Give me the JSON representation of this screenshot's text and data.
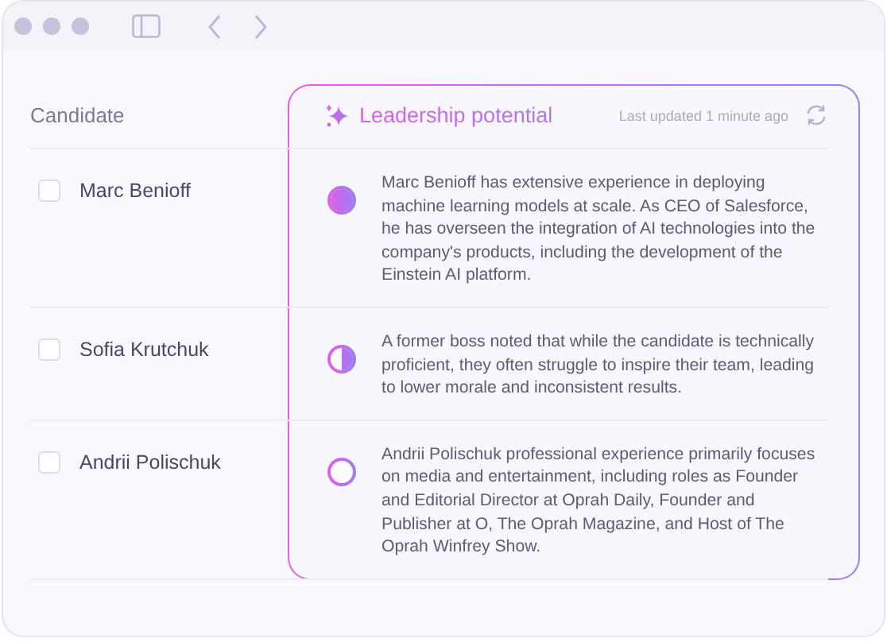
{
  "table": {
    "column_header": "Candidate",
    "panel": {
      "title": "Leadership potential",
      "updated": "Last updated 1 minute ago"
    },
    "rows": [
      {
        "name": "Marc Benioff",
        "checked": false,
        "level": 1,
        "summary": "Marc Benioff has extensive experience in deploying machine learning models at scale. As CEO of Salesforce, he has overseen the integration of AI technologies into the company's products, including the development of the Einstein AI platform."
      },
      {
        "name": "Sofia Krutchuk",
        "checked": false,
        "level": 0.5,
        "summary": "A former boss noted that while the candidate is technically proficient, they often struggle to inspire their team, leading to lower morale and inconsistent results."
      },
      {
        "name": "Andrii Polischuk",
        "checked": false,
        "level": 0,
        "summary": "Andrii Polischuk professional experience primarily focuses on media and entertainment, including roles as Founder and Editorial Director at Oprah Daily, Founder and Publisher at O, The Oprah Magazine, and Host of The Oprah Winfrey Show."
      }
    ]
  }
}
